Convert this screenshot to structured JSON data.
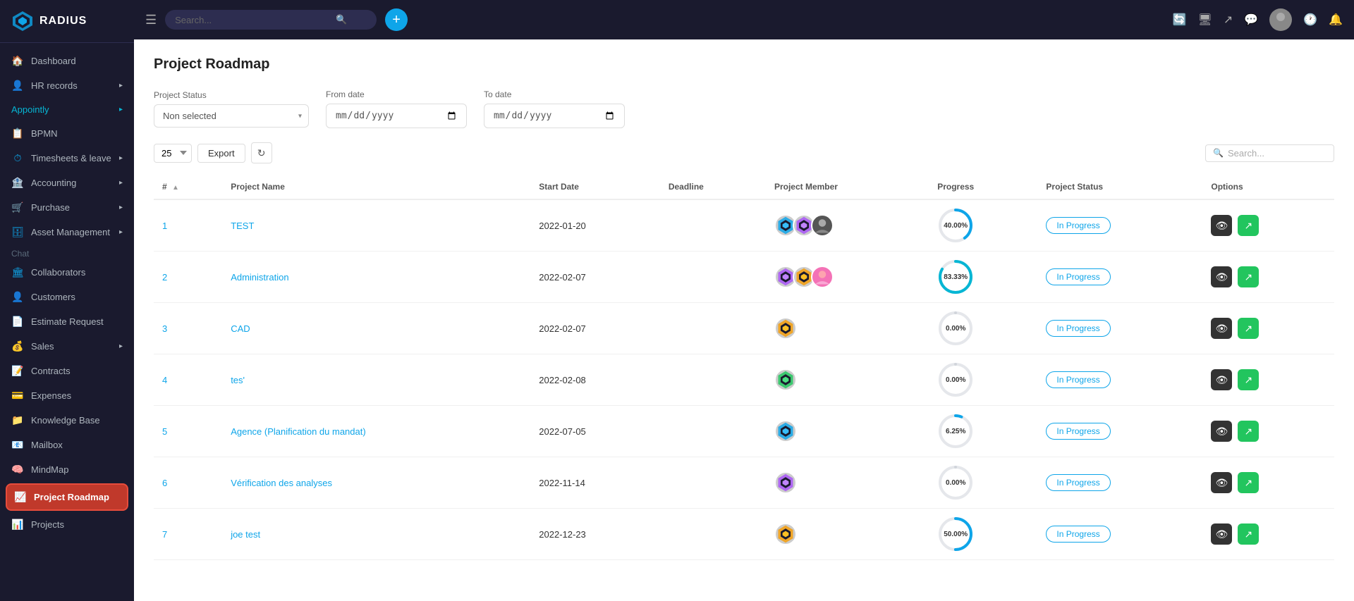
{
  "app": {
    "name": "RADIUS"
  },
  "topbar": {
    "search_placeholder": "Search...",
    "add_button_label": "+",
    "search_label": "Search ."
  },
  "sidebar": {
    "items": [
      {
        "id": "dashboard",
        "label": "Dashboard",
        "icon": "🏠",
        "color": "icon-blue",
        "chevron": false
      },
      {
        "id": "hr-records",
        "label": "HR records",
        "icon": "👤",
        "color": "icon-cyan",
        "chevron": true
      },
      {
        "id": "appointly-label",
        "label": "Appointly",
        "color": "icon-cyan",
        "chevron": true,
        "section": true
      },
      {
        "id": "bpmn",
        "label": "BPMN",
        "icon": "📋",
        "color": "icon-blue",
        "chevron": false
      },
      {
        "id": "timesheets",
        "label": "Timesheets & leave",
        "icon": "⏱",
        "color": "icon-blue",
        "chevron": true
      },
      {
        "id": "accounting",
        "label": "Accounting",
        "icon": "🏦",
        "color": "icon-blue",
        "chevron": true
      },
      {
        "id": "purchase",
        "label": "Purchase",
        "icon": "🛒",
        "color": "icon-blue",
        "chevron": true
      },
      {
        "id": "asset-management",
        "label": "Asset Management",
        "icon": "🗄",
        "color": "icon-blue",
        "chevron": true
      },
      {
        "id": "chat-label",
        "label": "Chat",
        "color": "",
        "section": true
      },
      {
        "id": "collaborators",
        "label": "Collaborators",
        "icon": "🏛",
        "color": "icon-blue",
        "chevron": false
      },
      {
        "id": "customers",
        "label": "Customers",
        "icon": "👤",
        "color": "icon-blue",
        "chevron": false
      },
      {
        "id": "estimate-request",
        "label": "Estimate Request",
        "icon": "📄",
        "color": "icon-blue",
        "chevron": false
      },
      {
        "id": "sales",
        "label": "Sales",
        "icon": "💰",
        "color": "icon-blue",
        "chevron": true
      },
      {
        "id": "contracts",
        "label": "Contracts",
        "icon": "📝",
        "color": "icon-blue",
        "chevron": false
      },
      {
        "id": "expenses",
        "label": "Expenses",
        "icon": "💳",
        "color": "icon-blue",
        "chevron": false
      },
      {
        "id": "knowledge-base",
        "label": "Knowledge Base",
        "icon": "📁",
        "color": "icon-blue",
        "chevron": false
      },
      {
        "id": "mailbox",
        "label": "Mailbox",
        "icon": "📧",
        "color": "icon-blue",
        "chevron": false
      },
      {
        "id": "mindmap",
        "label": "MindMap",
        "icon": "🧠",
        "color": "icon-blue",
        "chevron": false
      },
      {
        "id": "project-roadmap",
        "label": "Project Roadmap",
        "icon": "📈",
        "color": "icon-red",
        "chevron": false,
        "active": true
      },
      {
        "id": "projects",
        "label": "Projects",
        "icon": "📊",
        "color": "icon-blue",
        "chevron": false
      }
    ]
  },
  "page": {
    "title": "Project Roadmap",
    "filter": {
      "project_status_label": "Project Status",
      "project_status_placeholder": "Non selected",
      "from_date_label": "From date",
      "to_date_label": "To date"
    },
    "toolbar": {
      "per_page": "25",
      "export_label": "Export",
      "search_placeholder": "Search..."
    },
    "table": {
      "columns": [
        "#",
        "Project Name",
        "Start Date",
        "Deadline",
        "Project Member",
        "Progress",
        "Project Status",
        "Options"
      ],
      "rows": [
        {
          "num": "1",
          "name": "TEST",
          "start_date": "2022-01-20",
          "deadline": "",
          "progress": 40,
          "progress_label": "40.00%",
          "status": "In Progress",
          "members": 2
        },
        {
          "num": "2",
          "name": "Administration",
          "start_date": "2022-02-07",
          "deadline": "",
          "progress": 83.33,
          "progress_label": "83.33%",
          "status": "In Progress",
          "members": 2
        },
        {
          "num": "3",
          "name": "CAD",
          "start_date": "2022-02-07",
          "deadline": "",
          "progress": 0,
          "progress_label": "0.00%",
          "status": "In Progress",
          "members": 1
        },
        {
          "num": "4",
          "name": "tes'",
          "start_date": "2022-02-08",
          "deadline": "",
          "progress": 0,
          "progress_label": "0.00%",
          "status": "In Progress",
          "members": 1
        },
        {
          "num": "5",
          "name": "Agence      (Planification du mandat)",
          "start_date": "2022-07-05",
          "deadline": "",
          "progress": 6.25,
          "progress_label": "6.25%",
          "status": "In Progress",
          "members": 1
        },
        {
          "num": "6",
          "name": "Vérification des analyses",
          "start_date": "2022-11-14",
          "deadline": "",
          "progress": 0,
          "progress_label": "0.00%",
          "status": "In Progress",
          "members": 1
        },
        {
          "num": "7",
          "name": "joe test",
          "start_date": "2022-12-23",
          "deadline": "",
          "progress": 50,
          "progress_label": "50.00%",
          "status": "In Progress",
          "members": 1
        }
      ]
    }
  },
  "colors": {
    "sidebar_bg": "#1a1a2e",
    "accent_blue": "#0ea5e9",
    "accent_red": "#ef4444",
    "progress_blue": "#0ea5e9",
    "progress_gray": "#e5e7eb",
    "badge_blue": "#0ea5e9",
    "active_item": "#c0392b"
  }
}
